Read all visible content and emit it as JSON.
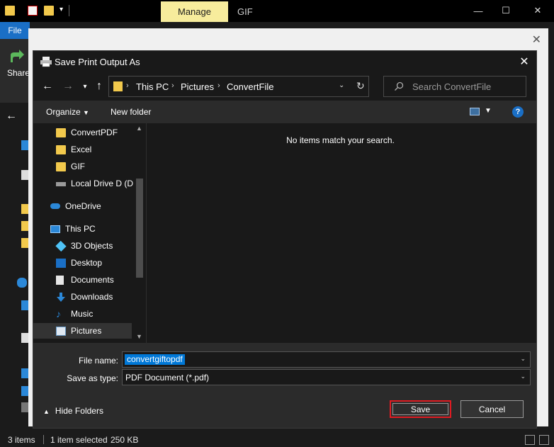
{
  "explorer": {
    "ribbon_context_tab": "Manage",
    "window_title": "GIF",
    "file_tab": "File",
    "share_label": "Share",
    "status": {
      "items": "3 items",
      "selected": "1 item selected",
      "size": "250 KB"
    }
  },
  "dialog": {
    "title": "Save Print Output As",
    "breadcrumb": [
      "This PC",
      "Pictures",
      "ConvertFile"
    ],
    "search_placeholder": "Search ConvertFile",
    "toolbar": {
      "organize": "Organize",
      "new_folder": "New folder",
      "help": "?"
    },
    "nav_items": [
      {
        "label": "ConvertPDF",
        "icon": "folder-icon"
      },
      {
        "label": "Excel",
        "icon": "folder-icon"
      },
      {
        "label": "GIF",
        "icon": "folder-icon"
      },
      {
        "label": "Local Drive D (D:",
        "icon": "drive-icon"
      },
      {
        "label": "OneDrive",
        "icon": "cloud-icon"
      },
      {
        "label": "This PC",
        "icon": "computer-icon"
      },
      {
        "label": "3D Objects",
        "icon": "cube-icon"
      },
      {
        "label": "Desktop",
        "icon": "desktop-icon"
      },
      {
        "label": "Documents",
        "icon": "document-icon"
      },
      {
        "label": "Downloads",
        "icon": "download-icon"
      },
      {
        "label": "Music",
        "icon": "music-icon"
      },
      {
        "label": "Pictures",
        "icon": "pictures-icon"
      }
    ],
    "selected_nav": "Pictures",
    "empty_message": "No items match your search.",
    "file_name_label": "File name:",
    "file_name_value": "convertgiftopdf",
    "save_type_label": "Save as type:",
    "save_type_value": "PDF Document (*.pdf)",
    "hide_folders": "Hide Folders",
    "save_button": "Save",
    "cancel_button": "Cancel",
    "highlight_color": "#e01b22"
  }
}
